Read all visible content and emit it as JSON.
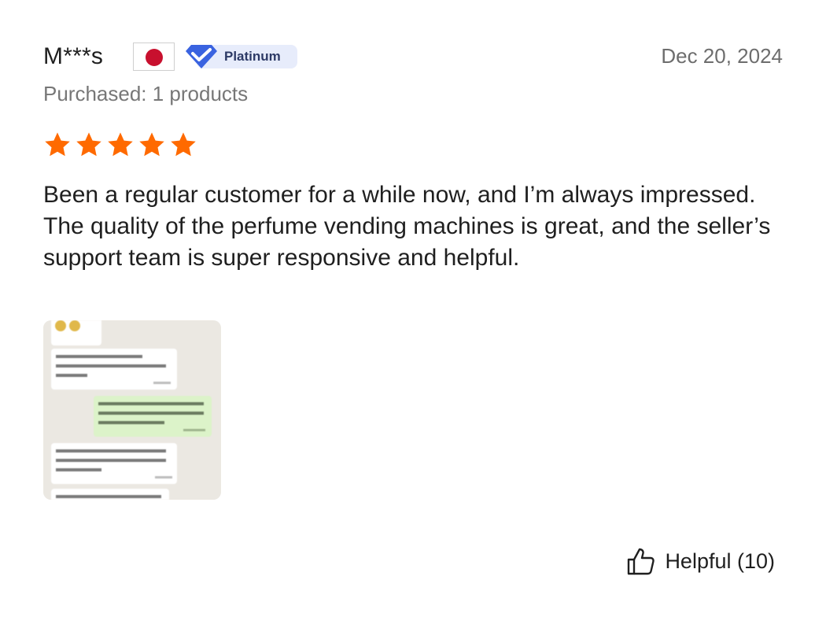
{
  "review": {
    "reviewer_name": "M***s",
    "country_flag": "japan-flag-icon",
    "tier_badge": "Platinum",
    "date": "Dec 20, 2024",
    "purchased": "Purchased: 1 products",
    "rating": {
      "value": 5,
      "max": 5,
      "color": "#ff6a00"
    },
    "text": "Been a regular customer for a while now, and I’m always impressed. The quality of the perfume vending machines is great, and the seller’s support team is super responsive and helpful.",
    "photo": {
      "icon": "chat-screenshot-thumbnail",
      "chat_lines": [
        "If you were to rate our product, how would you rate it? 1-10",
        "8 if the machine has more appearance, it can attract more customers",
        "Ok, we are already designing more styles, you can visit our Alibaba store",
        "you can also rate our store"
      ]
    },
    "helpful": {
      "label": "Helpful (10)",
      "icon": "thumbs-up-icon"
    }
  },
  "colors": {
    "accent_star": "#ff6a00",
    "badge_bg": "#e7ecfb",
    "badge_icon": "#3a63e0",
    "flag_red": "#c8102e"
  }
}
